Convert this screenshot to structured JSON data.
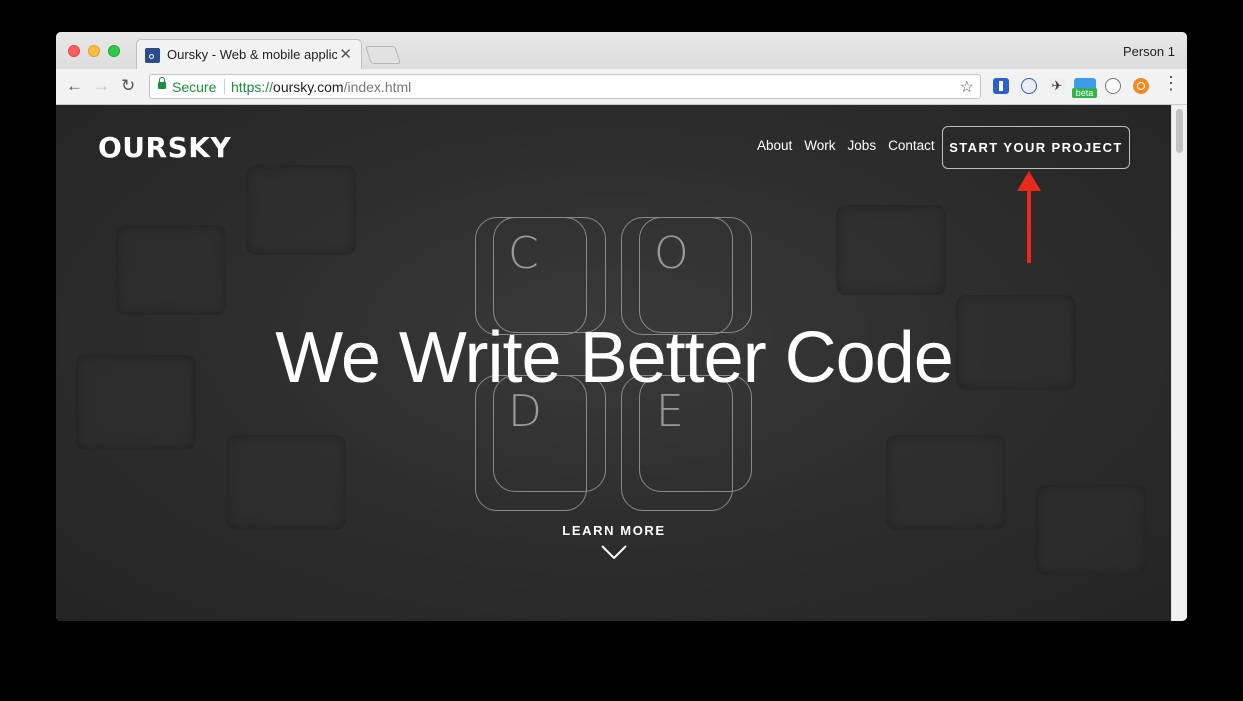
{
  "browser": {
    "tab_title": "Oursky - Web & mobile applica",
    "tab_close": "✕",
    "profile": "Person 1",
    "security_label": "Secure",
    "url_scheme": "https://",
    "url_host": "oursky.com",
    "url_path": "/index.html",
    "back_icon": "←",
    "forward_icon": "→",
    "reload_icon": "↻",
    "star_icon": "☆",
    "menu_icon": "⋮",
    "extensions": [
      {
        "name": "extension-blue-bar-icon"
      },
      {
        "name": "extension-circle-h-icon",
        "glyph": "H"
      },
      {
        "name": "extension-bird-icon",
        "glyph": "✈"
      },
      {
        "name": "extension-beta-icon",
        "badge": "beta"
      },
      {
        "name": "extension-person-icon"
      },
      {
        "name": "extension-orange-circle-icon"
      }
    ]
  },
  "site": {
    "logo": "OURSKY",
    "nav": [
      "About",
      "Work",
      "Jobs",
      "Contact"
    ],
    "cta": "START YOUR PROJECT",
    "headline": "We Write Better Code",
    "key_letters": [
      "C",
      "O",
      "D",
      "E"
    ],
    "learn_more": "LEARN MORE"
  },
  "colors": {
    "secure_green": "#1b8f3a",
    "annotation_red": "#e8291c",
    "hero_bg": "#2c2c2c"
  }
}
